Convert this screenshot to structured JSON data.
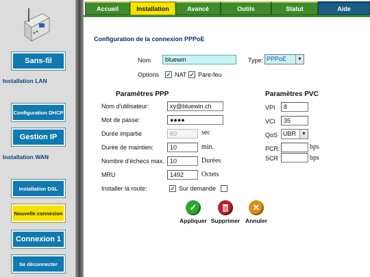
{
  "tabs": [
    {
      "label": "Accueil"
    },
    {
      "label": "Installation"
    },
    {
      "label": "Avancé"
    },
    {
      "label": "Outils"
    },
    {
      "label": "Statut"
    },
    {
      "label": "Aide"
    }
  ],
  "sidebar": {
    "btn_sansfil": "Sans-fil",
    "label_lan": "Installation LAN",
    "btn_dhcp": "Configuration DHCP",
    "btn_gestion_ip": "Gestion IP",
    "label_wan": "Installation WAN",
    "btn_dsl": "Installation DSL",
    "btn_nouvelle": "Nouvelle connexion",
    "btn_connexion1": "Connexion 1",
    "btn_deconnecter": "Se déconnecter"
  },
  "form": {
    "title": "Configuration de la connexion PPPoE",
    "nom_label": "Nom",
    "nom_value": "bluewin",
    "type_label": "Type:",
    "type_value": "PPPoE",
    "options_label": "Options",
    "nat_label": "NAT",
    "nat_checked": "✓",
    "parefeu_label": "Pare-feu",
    "parefeu_checked": "✓"
  },
  "ppp": {
    "header": "Paramètres PPP",
    "user_label": "Nom d'utilisateur:",
    "user_value": "xy@bluewin.ch",
    "pass_label": "Mot de passe:",
    "pass_value": "●●●●",
    "duree_label": "Durée impartie",
    "duree_value": "60",
    "duree_unit": "sec",
    "maintien_label": "Durée de maintien:",
    "maintien_value": "10",
    "maintien_unit": "min.",
    "echecs_label": "Nombre d'échecs max.",
    "echecs_value": "10",
    "echecs_unit": "Durées",
    "mru_label": "MRU",
    "mru_value": "1492",
    "mru_unit": "Octets",
    "route_label": "Installer la route:",
    "route_checked": "✓",
    "route_option": "Sur demande"
  },
  "pvc": {
    "header": "Paramètres PVC",
    "vpi_label": "VPI",
    "vpi_value": "8",
    "vci_label": "VCI",
    "vci_value": "35",
    "qos_label": "QoS",
    "qos_value": "UBR",
    "pcr_label": "PCR:",
    "pcr_value": "",
    "pcr_unit": "bps",
    "scr_label": "SCR",
    "scr_value": "",
    "scr_unit": "bps"
  },
  "actions": {
    "apply": "Appliquer",
    "delete": "Supprimer",
    "cancel": "Annuler"
  },
  "colors": {
    "tab_green": "#3f8a2c",
    "tab_active": "#f4e40c",
    "tab_help": "#1b5e82",
    "sidebar_button": "#1279ad",
    "sidebar_active": "#f3e20a",
    "apply_icon": "#2ea62e",
    "delete_icon": "#b4232a",
    "cancel_icon": "#e08a1a"
  }
}
